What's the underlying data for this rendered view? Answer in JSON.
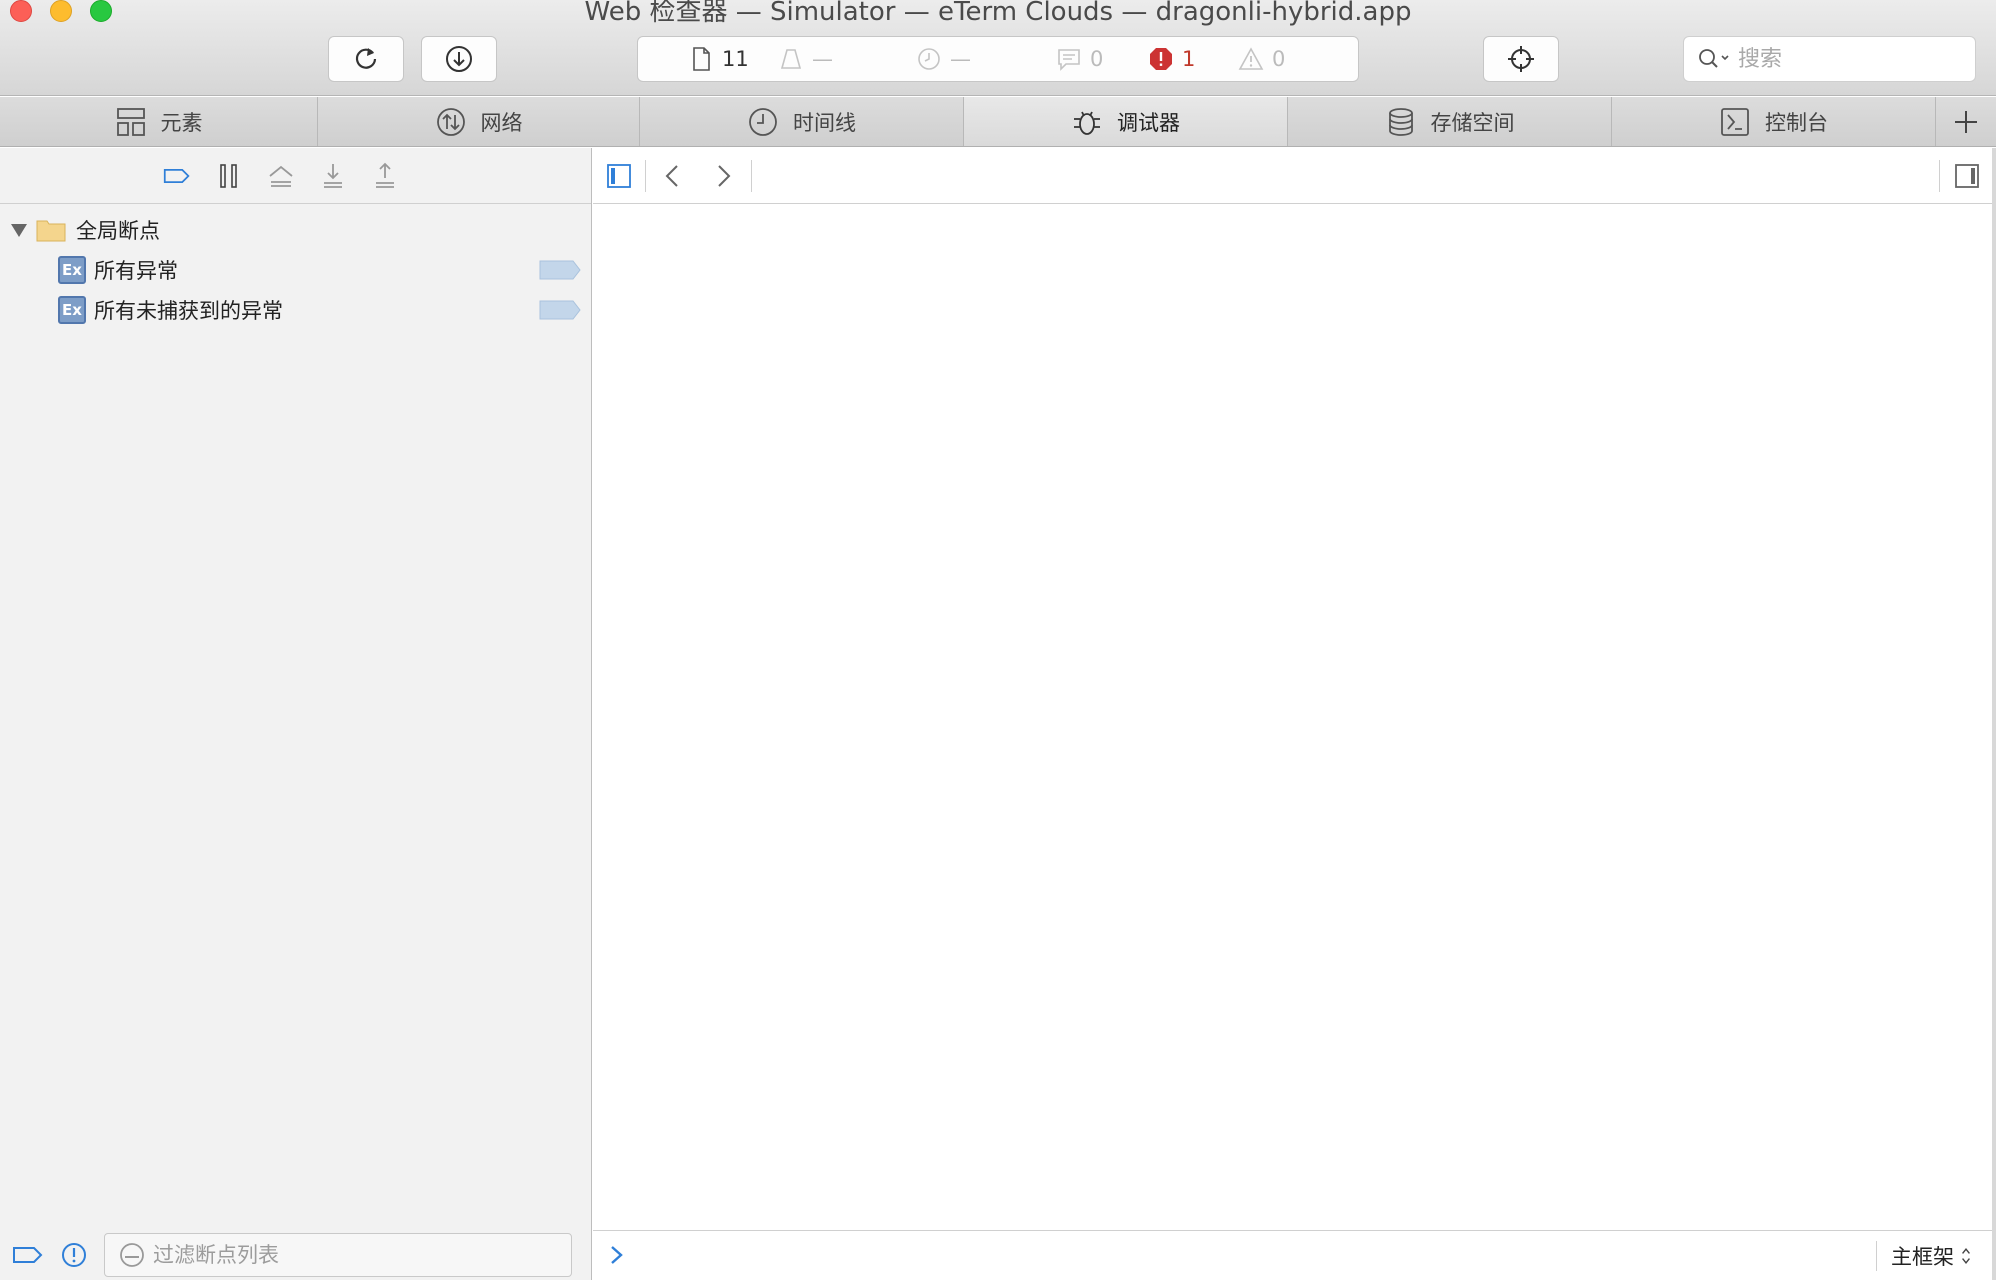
{
  "window": {
    "title": "Web 检查器 — Simulator — eTerm Clouds — dragonli-hybrid.app"
  },
  "activity": {
    "resources_count": "11",
    "load_placeholder": "—",
    "time_placeholder": "—",
    "logs_count": "0",
    "errors_count": "1",
    "warnings_count": "0"
  },
  "search": {
    "placeholder": "搜索"
  },
  "tabs": [
    {
      "label": "元素",
      "icon": "elements-icon"
    },
    {
      "label": "网络",
      "icon": "network-icon"
    },
    {
      "label": "时间线",
      "icon": "timeline-icon"
    },
    {
      "label": "调试器",
      "icon": "debugger-icon",
      "active": true
    },
    {
      "label": "存储空间",
      "icon": "storage-icon"
    },
    {
      "label": "控制台",
      "icon": "console-icon"
    }
  ],
  "breakpoints": {
    "group_label": "全局断点",
    "items": [
      {
        "badge": "Ex",
        "label": "所有异常"
      },
      {
        "badge": "Ex",
        "label": "所有未捕获到的异常"
      }
    ],
    "filter_placeholder": "过滤断点列表"
  },
  "console": {
    "frame_label": "主框架"
  },
  "colors": {
    "accent": "#2f7fd8",
    "error": "#cc3333",
    "sidebar_bg": "#f2f2f2",
    "exception_badge": "#7d9dc7"
  }
}
